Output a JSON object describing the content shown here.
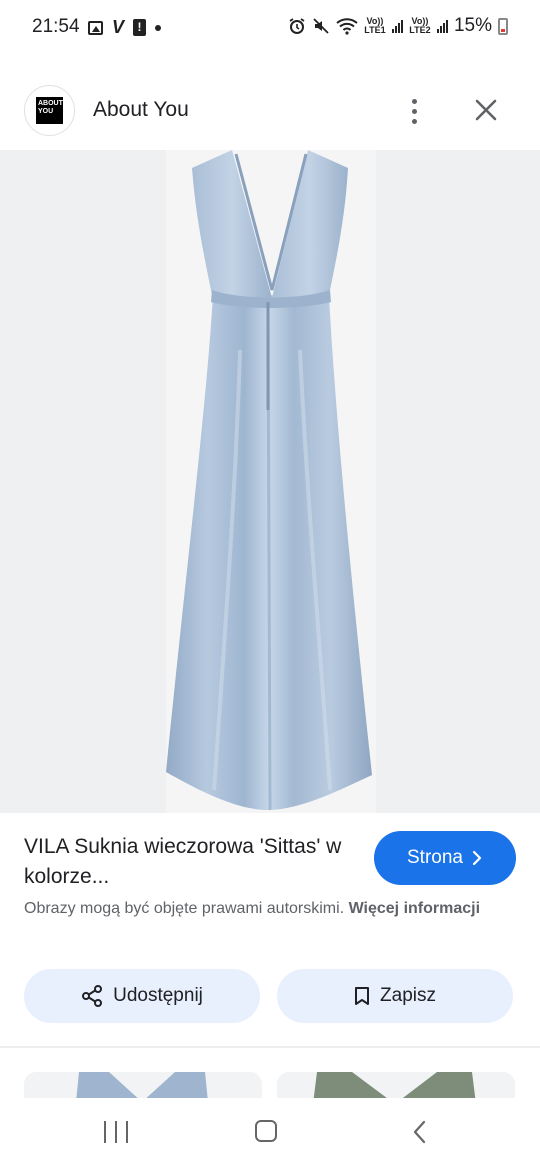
{
  "status_bar": {
    "time": "21:54",
    "left_icons": [
      "image-icon",
      "v-icon",
      "alert-icon",
      "dot-icon"
    ],
    "network_1": "Vo)) LTE1",
    "network_2": "Vo)) LTE2",
    "battery": "15%"
  },
  "header": {
    "logo_text": "ABOUT YOU",
    "site_name": "About You",
    "icons": [
      "more-vert-icon",
      "close-icon"
    ]
  },
  "product": {
    "title": "VILA Suknia wieczorowa 'Sittas' w kolorze...",
    "visit_label": "Strona",
    "copyright_text": "Obrazy mogą być objęte prawami autorskimi.",
    "more_info_label": "Więcej informacji"
  },
  "actions": {
    "share_label": "Udostępnij",
    "save_label": "Zapisz"
  },
  "colors": {
    "accent": "#1a73e8",
    "action_bg": "#e8f0fe",
    "dress": "#a6bcd6"
  }
}
